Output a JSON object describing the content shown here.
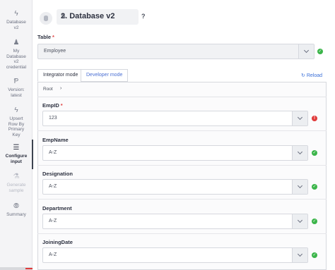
{
  "sidebar": {
    "steps": [
      {
        "icon": "lightning-icon",
        "glyph": "ϟ",
        "label_lines": [
          "Database",
          "v2"
        ],
        "state": "normal"
      },
      {
        "icon": "user-icon",
        "glyph": "♟",
        "label_lines": [
          "My",
          "Database",
          "v2",
          "credential"
        ],
        "state": "normal"
      },
      {
        "icon": "version-icon",
        "glyph": "Ᵽ",
        "label_lines": [
          "Version:",
          "latest"
        ],
        "state": "normal"
      },
      {
        "icon": "lightning-icon",
        "glyph": "ϟ",
        "label_lines": [
          "Upsert",
          "Row By",
          "Primary",
          "Key"
        ],
        "state": "normal"
      },
      {
        "icon": "menu-icon",
        "glyph": "☰",
        "label_lines": [
          "Configure",
          "input"
        ],
        "state": "active"
      },
      {
        "icon": "flask-icon",
        "glyph": "⚗",
        "label_lines": [
          "Generate",
          "sample"
        ],
        "state": "disabled"
      },
      {
        "icon": "binoculars-icon",
        "glyph": "⦾",
        "label_lines": [
          "Summary"
        ],
        "state": "normal"
      }
    ]
  },
  "header": {
    "title": "2. Database v2",
    "edit_icon": "pencil-icon",
    "help_label": "?"
  },
  "table_field": {
    "label": "Table",
    "required_mark": "*",
    "value": "Employee",
    "status": "ok"
  },
  "tabs": [
    {
      "label": "Integrator mode",
      "active": true
    },
    {
      "label": "Developer mode",
      "active": false
    }
  ],
  "reload_label": "Reload",
  "breadcrumb": {
    "root": "Root",
    "chevron": "›"
  },
  "fields": [
    {
      "label": "EmpID",
      "required_mark": "*",
      "value": "123",
      "status": "err"
    },
    {
      "label": "EmpName",
      "required_mark": "",
      "value": "A-Z",
      "status": "ok"
    },
    {
      "label": "Designation",
      "required_mark": "",
      "value": "A-Z",
      "status": "ok"
    },
    {
      "label": "Department",
      "required_mark": "",
      "value": "A-Z",
      "status": "ok"
    },
    {
      "label": "JoiningDate",
      "required_mark": "",
      "value": "A-Z",
      "status": "ok"
    }
  ],
  "status_glyphs": {
    "ok": "✓",
    "err": "!"
  }
}
